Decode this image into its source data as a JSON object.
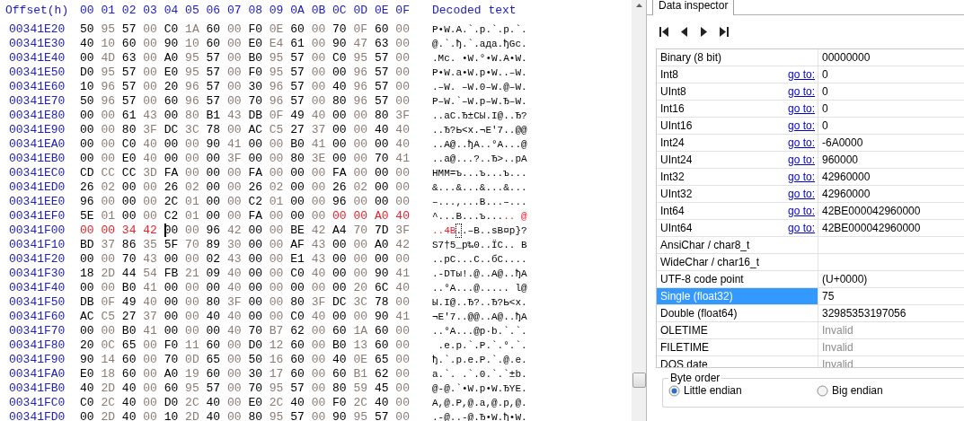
{
  "hex_view": {
    "offset_label": "Offset(h)",
    "columns": [
      "00",
      "01",
      "02",
      "03",
      "04",
      "05",
      "06",
      "07",
      "08",
      "09",
      "0A",
      "0B",
      "0C",
      "0D",
      "0E",
      "0F"
    ],
    "decoded_label": "Decoded text",
    "rows": [
      {
        "offset": "00341E20",
        "hex": [
          {
            "bytes": "50 95 57 00 C0 1A 60 00 F0 0E 60 00 70 0F 60 00",
            "selected": false,
            "cursor": false
          }
        ],
        "text": [
          {
            "chars": "P•W.А.`.р.`.p.`.",
            "selected": false,
            "cursor": false
          }
        ]
      },
      {
        "offset": "00341E30",
        "hex": [
          {
            "bytes": "40 10 60 00 90 10 60 00 E0 E4 61 00 90 47 63 00",
            "selected": false,
            "cursor": false
          }
        ],
        "text": [
          {
            "chars": "@.`.ђ.`.адa.ђGc.",
            "selected": false,
            "cursor": false
          }
        ]
      },
      {
        "offset": "00341E40",
        "hex": [
          {
            "bytes": "00 4D 63 00 A0 95 57 00 B0 95 57 00 C0 95 57 00",
            "selected": false,
            "cursor": false
          }
        ],
        "text": [
          {
            "chars": ".Mc. •W.°•W.А•W.",
            "selected": false,
            "cursor": false
          }
        ]
      },
      {
        "offset": "00341E50",
        "hex": [
          {
            "bytes": "D0 95 57 00 E0 95 57 00 F0 95 57 00 00 96 57 00",
            "selected": false,
            "cursor": false
          }
        ],
        "text": [
          {
            "chars": "Р•W.а•W.р•W..–W.",
            "selected": false,
            "cursor": false
          }
        ]
      },
      {
        "offset": "00341E60",
        "hex": [
          {
            "bytes": "10 96 57 00 20 96 57 00 30 96 57 00 40 96 57 00",
            "selected": false,
            "cursor": false
          }
        ],
        "text": [
          {
            "chars": ".–W. –W.0–W.@–W.",
            "selected": false,
            "cursor": false
          }
        ]
      },
      {
        "offset": "00341E70",
        "hex": [
          {
            "bytes": "50 96 57 00 60 96 57 00 70 96 57 00 80 96 57 00",
            "selected": false,
            "cursor": false
          }
        ],
        "text": [
          {
            "chars": "P–W.`–W.p–W.Ђ–W.",
            "selected": false,
            "cursor": false
          }
        ]
      },
      {
        "offset": "00341E80",
        "hex": [
          {
            "bytes": "00 00 61 43 00 80 B1 43 DB 0F 49 40 00 00 80 3F",
            "selected": false,
            "cursor": false
          }
        ],
        "text": [
          {
            "chars": "..aC.Ђ±CЫ.I@..Ђ?",
            "selected": false,
            "cursor": false
          }
        ]
      },
      {
        "offset": "00341E90",
        "hex": [
          {
            "bytes": "00 00 80 3F DC 3C 78 00 AC C5 27 37 00 00 40 40",
            "selected": false,
            "cursor": false
          }
        ],
        "text": [
          {
            "chars": "..Ђ?Ь<x.¬Е'7..@@",
            "selected": false,
            "cursor": false
          }
        ]
      },
      {
        "offset": "00341EA0",
        "hex": [
          {
            "bytes": "00 00 C0 40 00 00 90 41 00 00 B0 41 00 00 00 40",
            "selected": false,
            "cursor": false
          }
        ],
        "text": [
          {
            "chars": "..А@..ђA..°A...@",
            "selected": false,
            "cursor": false
          }
        ]
      },
      {
        "offset": "00341EB0",
        "hex": [
          {
            "bytes": "00 00 E0 40 00 00 00 3F 00 00 80 3E 00 00 70 41",
            "selected": false,
            "cursor": false
          }
        ],
        "text": [
          {
            "chars": "..а@...?..Ђ>..pA",
            "selected": false,
            "cursor": false
          }
        ]
      },
      {
        "offset": "00341EC0",
        "hex": [
          {
            "bytes": "CD CC CC 3D FA 00 00 00 FA 00 00 00 FA 00 00 00",
            "selected": false,
            "cursor": false
          }
        ],
        "text": [
          {
            "chars": "НММ=ъ...ъ...ъ...",
            "selected": false,
            "cursor": false
          }
        ]
      },
      {
        "offset": "00341ED0",
        "hex": [
          {
            "bytes": "26 02 00 00 26 02 00 00 26 02 00 00 26 02 00 00",
            "selected": false,
            "cursor": false
          }
        ],
        "text": [
          {
            "chars": "&...&...&...&...",
            "selected": false,
            "cursor": false
          }
        ]
      },
      {
        "offset": "00341EE0",
        "hex": [
          {
            "bytes": "96 00 00 00 2C 01 00 00 C2 01 00 00 96 00 00 00",
            "selected": false,
            "cursor": false
          }
        ],
        "text": [
          {
            "chars": "–...,...В...–...",
            "selected": false,
            "cursor": false
          }
        ]
      },
      {
        "offset": "00341EF0",
        "hex": [
          {
            "bytes": "5E 01 00 00 C2 01 00 00 FA 00 00 00",
            "selected": false,
            "cursor": false
          },
          {
            "bytes": "00 00 A0 40",
            "selected": true,
            "cursor": false
          }
        ],
        "text": [
          {
            "chars": "^...В...ъ...",
            "selected": false,
            "cursor": false
          },
          {
            "chars": ".. @",
            "selected": true,
            "cursor": false
          }
        ]
      },
      {
        "offset": "00341F00",
        "hex": [
          {
            "bytes": "00 00 34 42",
            "selected": true,
            "cursor": false
          },
          {
            "bytes": "00 00 96 42 00 00 BE 42 A4 70 7D 3F",
            "selected": false,
            "cursor": true
          }
        ],
        "text": [
          {
            "chars": "..4B",
            "selected": true,
            "cursor": false
          },
          {
            "chars": ".",
            "selected": false,
            "cursor": true
          },
          {
            "chars": ".–B..ѕB¤p}?",
            "selected": false,
            "cursor": false
          }
        ]
      },
      {
        "offset": "00341F10",
        "hex": [
          {
            "bytes": "BD 37 86 35 5F 70 89 30 00 00 AF 43 00 00 A0 42",
            "selected": false,
            "cursor": false
          }
        ],
        "text": [
          {
            "chars": "Ѕ7†5_p‰0..ЇC.. B",
            "selected": false,
            "cursor": false
          }
        ]
      },
      {
        "offset": "00341F20",
        "hex": [
          {
            "bytes": "00 00 70 43 00 00 02 43 00 00 E1 43 00 00 00 00",
            "selected": false,
            "cursor": false
          }
        ],
        "text": [
          {
            "chars": "..pC...C..бC....",
            "selected": false,
            "cursor": false
          }
        ]
      },
      {
        "offset": "00341F30",
        "hex": [
          {
            "bytes": "18 2D 44 54 FB 21 09 40 00 00 C0 40 00 00 90 41",
            "selected": false,
            "cursor": false
          }
        ],
        "text": [
          {
            "chars": ".-DTы!.@..А@..ђA",
            "selected": false,
            "cursor": false
          }
        ]
      },
      {
        "offset": "00341F40",
        "hex": [
          {
            "bytes": "00 00 B0 41 00 00 00 40 00 00 00 00 00 20 6C 40",
            "selected": false,
            "cursor": false
          }
        ],
        "text": [
          {
            "chars": "..°A...@..... l@",
            "selected": false,
            "cursor": false
          }
        ]
      },
      {
        "offset": "00341F50",
        "hex": [
          {
            "bytes": "DB 0F 49 40 00 00 80 3F 00 00 80 3F DC 3C 78 00",
            "selected": false,
            "cursor": false
          }
        ],
        "text": [
          {
            "chars": "Ы.I@..Ђ?..Ђ?Ь<x.",
            "selected": false,
            "cursor": false
          }
        ]
      },
      {
        "offset": "00341F60",
        "hex": [
          {
            "bytes": "AC C5 27 37 00 00 40 40 00 00 C0 40 00 00 90 41",
            "selected": false,
            "cursor": false
          }
        ],
        "text": [
          {
            "chars": "¬Е'7..@@..А@..ђA",
            "selected": false,
            "cursor": false
          }
        ]
      },
      {
        "offset": "00341F70",
        "hex": [
          {
            "bytes": "00 00 B0 41 00 00 00 40 70 B7 62 00 60 1A 60 00",
            "selected": false,
            "cursor": false
          }
        ],
        "text": [
          {
            "chars": "..°A...@p·b.`.`.",
            "selected": false,
            "cursor": false
          }
        ]
      },
      {
        "offset": "00341F80",
        "hex": [
          {
            "bytes": "20 0C 65 00 F0 11 60 00 D0 12 60 00 B0 13 60 00",
            "selected": false,
            "cursor": false
          }
        ],
        "text": [
          {
            "chars": " .e.р.`.Р.`.°.`.",
            "selected": false,
            "cursor": false
          }
        ]
      },
      {
        "offset": "00341F90",
        "hex": [
          {
            "bytes": "90 14 60 00 70 0D 65 00 50 16 60 00 40 0E 65 00",
            "selected": false,
            "cursor": false
          }
        ],
        "text": [
          {
            "chars": "ђ.`.p.e.P.`.@.e.",
            "selected": false,
            "cursor": false
          }
        ]
      },
      {
        "offset": "00341FA0",
        "hex": [
          {
            "bytes": "E0 18 60 00 A0 19 60 00 30 17 60 00 60 B1 62 00",
            "selected": false,
            "cursor": false
          }
        ],
        "text": [
          {
            "chars": "а.`. .`.0.`.`±b.",
            "selected": false,
            "cursor": false
          }
        ]
      },
      {
        "offset": "00341FB0",
        "hex": [
          {
            "bytes": "40 2D 40 00 60 95 57 00 70 95 57 00 80 59 45 00",
            "selected": false,
            "cursor": false
          }
        ],
        "text": [
          {
            "chars": "@-@.`•W.p•W.ЂYE.",
            "selected": false,
            "cursor": false
          }
        ]
      },
      {
        "offset": "00341FC0",
        "hex": [
          {
            "bytes": "C0 2C 40 00 D0 2C 40 00 E0 2C 40 00 F0 2C 40 00",
            "selected": false,
            "cursor": false
          }
        ],
        "text": [
          {
            "chars": "А,@.Р,@.а,@.р,@.",
            "selected": false,
            "cursor": false
          }
        ]
      },
      {
        "offset": "00341FD0",
        "hex": [
          {
            "bytes": "00 2D 40 00 10 2D 40 00 80 95 57 00 90 95 57 00",
            "selected": false,
            "cursor": false
          }
        ],
        "text": [
          {
            "chars": ".-@..-@.Ђ•W.ђ•W.",
            "selected": false,
            "cursor": false
          }
        ]
      }
    ]
  },
  "inspector": {
    "tabs": [
      {
        "label": "Data inspector",
        "selected": true
      }
    ],
    "rows": [
      {
        "type": "Binary (8 bit)",
        "value": "00000000",
        "selected": false,
        "disabled": false
      },
      {
        "type": "Int8",
        "goto": "go to:",
        "value": "0",
        "selected": false,
        "disabled": false
      },
      {
        "type": "UInt8",
        "goto": "go to:",
        "value": "0",
        "selected": false,
        "disabled": false
      },
      {
        "type": "Int16",
        "goto": "go to:",
        "value": "0",
        "selected": false,
        "disabled": false
      },
      {
        "type": "UInt16",
        "goto": "go to:",
        "value": "0",
        "selected": false,
        "disabled": false
      },
      {
        "type": "Int24",
        "goto": "go to:",
        "value": "-6A0000",
        "selected": false,
        "disabled": false
      },
      {
        "type": "UInt24",
        "goto": "go to:",
        "value": "960000",
        "selected": false,
        "disabled": false
      },
      {
        "type": "Int32",
        "goto": "go to:",
        "value": "42960000",
        "selected": false,
        "disabled": false
      },
      {
        "type": "UInt32",
        "goto": "go to:",
        "value": "42960000",
        "selected": false,
        "disabled": false
      },
      {
        "type": "Int64",
        "goto": "go to:",
        "value": "42BE000042960000",
        "selected": false,
        "disabled": false
      },
      {
        "type": "UInt64",
        "goto": "go to:",
        "value": "42BE000042960000",
        "selected": false,
        "disabled": false
      },
      {
        "type": "AnsiChar / char8_t",
        "selected": false
      },
      {
        "type": "WideChar / char16_t",
        "selected": false
      },
      {
        "type": "UTF-8 code point",
        "value": "(U+0000)",
        "selected": false,
        "disabled": false
      },
      {
        "type": "Single (float32)",
        "value": "75",
        "selected": true,
        "disabled": false
      },
      {
        "type": "Double (float64)",
        "value": "32985353197056",
        "selected": false,
        "disabled": false
      },
      {
        "type": "OLETIME",
        "value": "Invalid",
        "selected": false,
        "disabled": true
      },
      {
        "type": "FILETIME",
        "value": "Invalid",
        "selected": false,
        "disabled": true
      },
      {
        "type": "DOS date",
        "value": "Invalid",
        "selected": false,
        "disabled": true
      }
    ],
    "byte_order": {
      "label": "Byte order",
      "options": [
        {
          "label": "Little endian",
          "selected": true
        },
        {
          "label": "Big endian",
          "selected": false
        }
      ]
    }
  }
}
